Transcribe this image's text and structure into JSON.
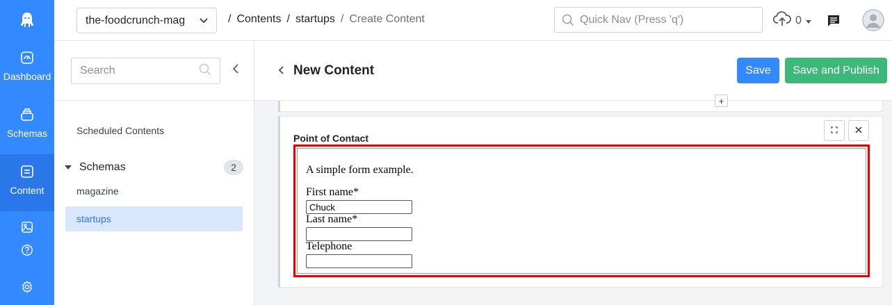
{
  "rail": {
    "items": [
      {
        "label": "Dashboard",
        "icon": "dashboard-icon"
      },
      {
        "label": "Schemas",
        "icon": "schemas-icon"
      },
      {
        "label": "Content",
        "icon": "content-icon"
      }
    ],
    "extra_icons": [
      "assets-icon",
      "help-icon",
      "settings-icon"
    ],
    "color": "#3389ff"
  },
  "topbar": {
    "app_name": "the-foodcrunch-mag",
    "breadcrumb": {
      "items": [
        "Contents",
        "startups"
      ],
      "current": "Create Content",
      "separator": "/"
    },
    "quicknav_placeholder": "Quick Nav (Press 'q')",
    "upload_count": "0"
  },
  "sidebar": {
    "search_placeholder": "Search",
    "scheduled": "Scheduled Contents",
    "schemas_label": "Schemas",
    "schemas_count": "2",
    "schema_items": [
      "magazine",
      "startups"
    ],
    "selected": "startups"
  },
  "editor": {
    "title": "New Content",
    "save_label": "Save",
    "publish_label": "Save and Publish",
    "add_label": "+",
    "field_label": "Point of Contact",
    "form": {
      "title": "A simple form example.",
      "first_name_label": "First name*",
      "first_name_value": "Chuck",
      "last_name_label": "Last name*",
      "last_name_value": "",
      "telephone_label": "Telephone",
      "telephone_value": ""
    }
  },
  "colors": {
    "save": "#3389ff",
    "publish": "#3cb879",
    "highlight": "#e00000"
  }
}
